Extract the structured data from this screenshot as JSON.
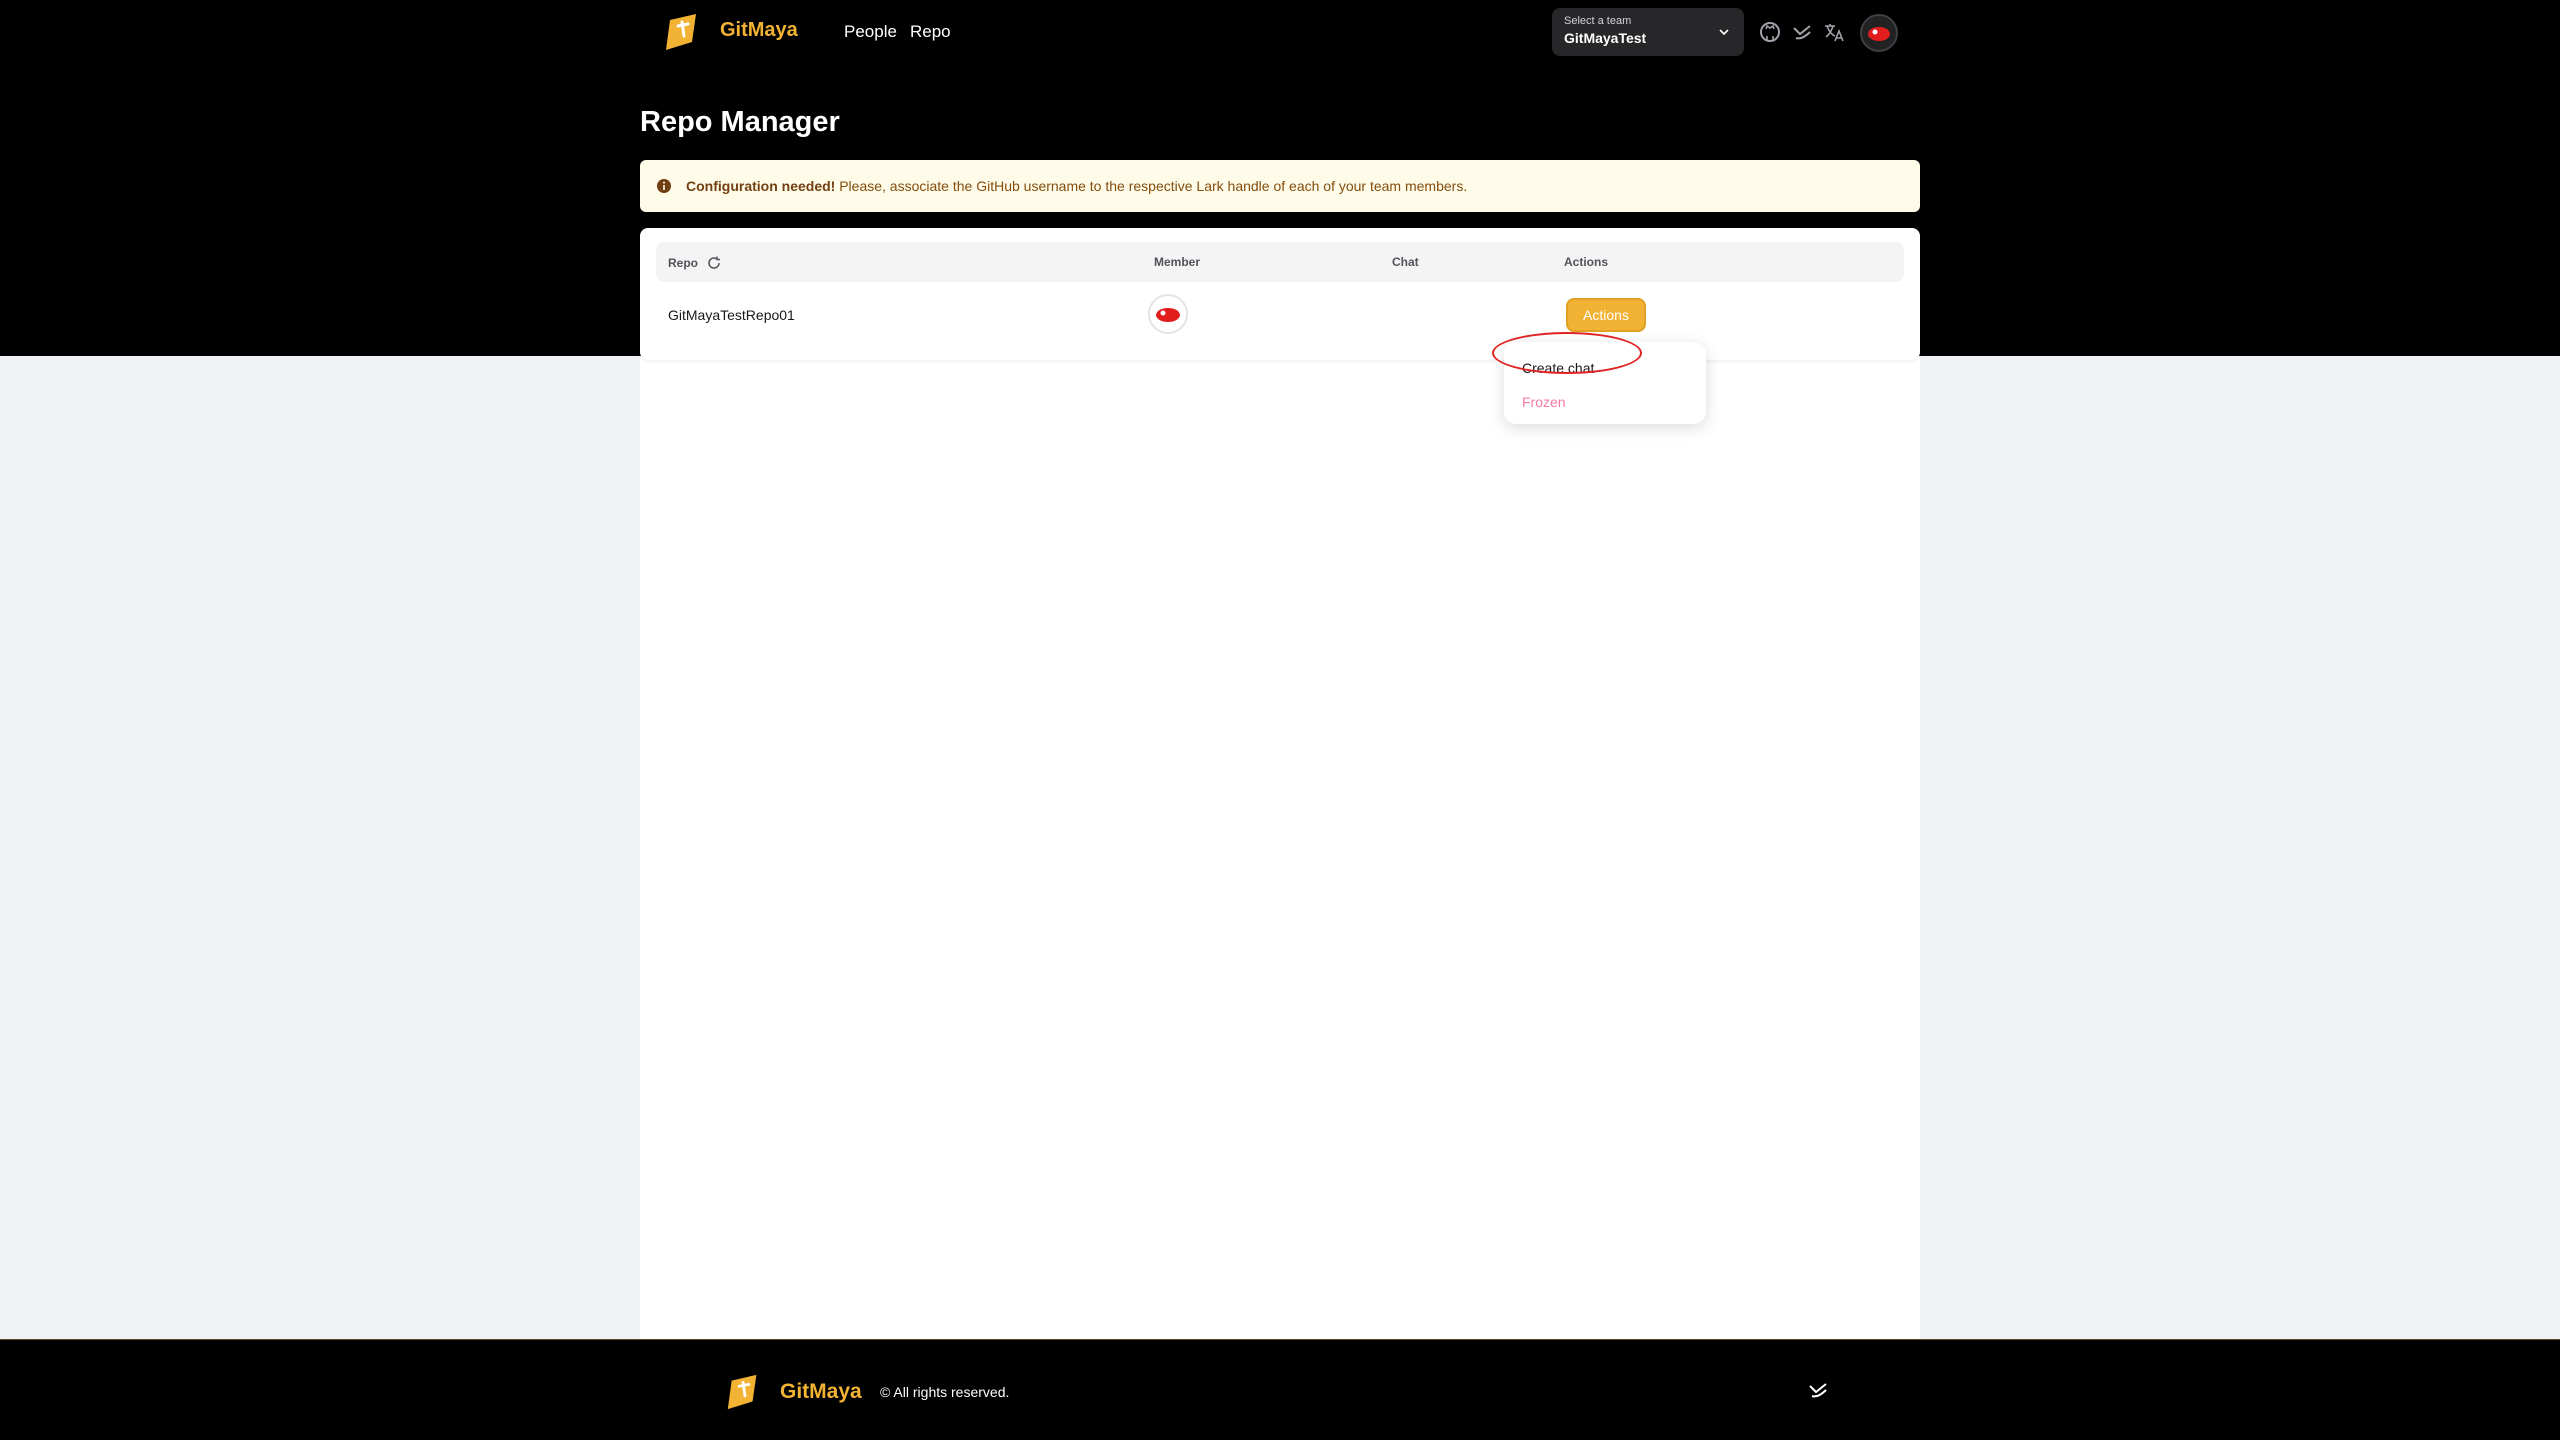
{
  "app": {
    "brand": "GitMaya"
  },
  "nav": {
    "people": "People",
    "repo": "Repo"
  },
  "team_select": {
    "label": "Select a team",
    "value": "GitMayaTest"
  },
  "page": {
    "title": "Repo Manager"
  },
  "alert": {
    "strong": "Configuration needed!",
    "text": " Please, associate the GitHub username to the respective Lark handle of each of your team members."
  },
  "table": {
    "headers": {
      "repo": "Repo",
      "member": "Member",
      "chat": "Chat",
      "actions": "Actions"
    },
    "rows": [
      {
        "repo": "GitMayaTestRepo01",
        "chat": "",
        "action_label": "Actions"
      }
    ]
  },
  "dropdown": {
    "create_chat": "Create chat",
    "frozen": "Frozen"
  },
  "footer": {
    "brand": "GitMaya",
    "copyright": "© All rights reserved."
  },
  "colors": {
    "accent": "#f2b233",
    "danger_text": "#f47aa5",
    "alert_bg": "#fefce8",
    "annotation": "#e02424"
  }
}
